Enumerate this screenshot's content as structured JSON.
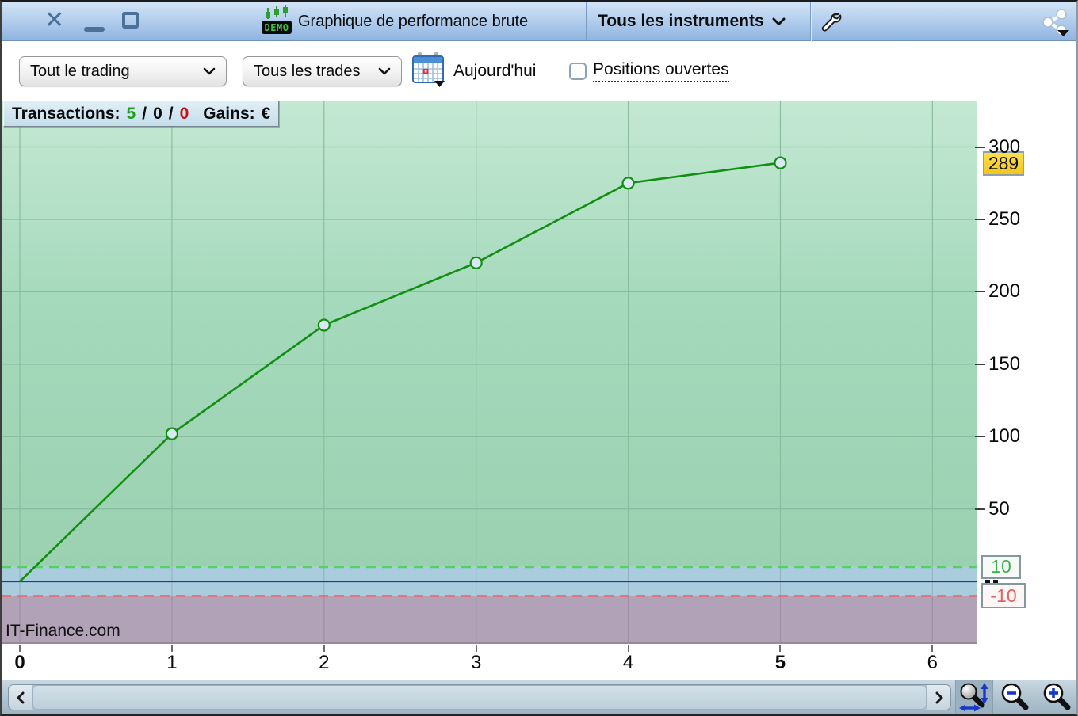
{
  "window": {
    "title": "Graphique de performance brute",
    "instrument_selector": {
      "label": "Tous les instruments"
    },
    "controls": {
      "close_glyph": "✕"
    }
  },
  "toolbar": {
    "scope_select": {
      "value": "Tout le trading"
    },
    "trades_select": {
      "value": "Tous les trades"
    },
    "date_label": "Aujourd'hui",
    "open_positions": {
      "label": "Positions ouvertes",
      "checked": false
    }
  },
  "stats": {
    "transactions_label": "Transactions:",
    "wins": "5",
    "breakeven": "0",
    "losses": "0",
    "separator": "/",
    "gains_label": "Gains:",
    "currency": "€"
  },
  "watermark": "IT-Finance.com",
  "chart_data": {
    "type": "line",
    "title": "Graphique de performance brute",
    "x": [
      0,
      1,
      2,
      3,
      4,
      5
    ],
    "values": [
      0,
      102,
      177,
      220,
      275,
      289
    ],
    "x_ticks": [
      0,
      1,
      2,
      3,
      4,
      5,
      6
    ],
    "x_bold_ticks": [
      0,
      5
    ],
    "y_ticks": [
      50,
      100,
      150,
      200,
      250,
      300
    ],
    "xlim": [
      -0.12,
      6.29
    ],
    "ylim": [
      -42,
      332
    ],
    "grid": true,
    "legend": null,
    "reference_lines": {
      "zero": 0,
      "upper_dashed": 10,
      "lower_dashed": -10
    },
    "badges": {
      "current": "289",
      "upper": "10",
      "lower": "-10"
    },
    "colors": {
      "line": "#118f11",
      "marker_fill": "#d9e9f1",
      "green_area_top": "#c4e8d3",
      "green_area_mid": "#a4d9bb",
      "green_area_bottom": "#9bd1b1",
      "neutral_band": "#aacddd",
      "negative_area": "#b1a2b7",
      "zero_line": "#2929cf",
      "upper_dashed": "#53d166",
      "lower_dashed": "#e96a67",
      "grid_h": "#86bb9e",
      "grid_v_green": "#89bd9e",
      "grid_v_blue": "#92b4c2",
      "grid_v_mauve": "#a08fa6",
      "badge_current_bg": "#f7ce2a",
      "badge_upper_text": "#3fae4f",
      "badge_lower_text": "#e2635f"
    }
  }
}
